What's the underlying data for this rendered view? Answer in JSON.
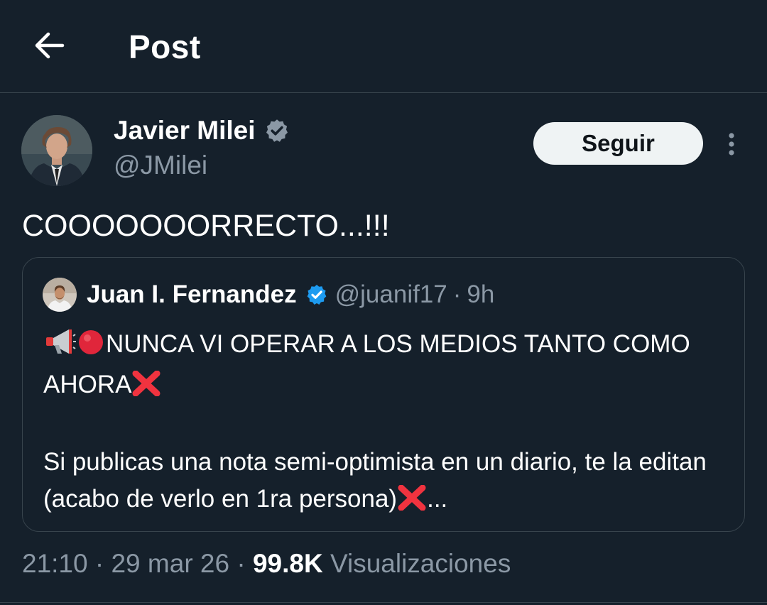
{
  "header": {
    "back_icon": "arrow-left-icon",
    "title": "Post"
  },
  "author": {
    "name": "Javier Milei",
    "handle": "@JMilei",
    "verified_icon": "verified-badge-icon",
    "verified_color": "#8b98a5"
  },
  "follow_button": {
    "label": "Seguir"
  },
  "more_icon": "more-vertical-icon",
  "tweet": {
    "text": "COOOOOOORRECTO...!!!"
  },
  "quote": {
    "name": "Juan I. Fernandez",
    "handle": "@juanif17",
    "separator": "·",
    "time": "9h",
    "verified_color": "#1d9bf0",
    "paragraph_1": "NUNCA VI OPERAR A LOS MEDIOS TANTO COMO AHORA",
    "paragraph_2": "Si publicas una nota semi-optimista en un diario, te la editan (acabo de verlo en 1ra persona)",
    "ellipsis": "..."
  },
  "meta": {
    "time": "21:10",
    "sep_1": " · ",
    "date": "29 mar 26",
    "sep_2": " · ",
    "views_count": "99.8K",
    "views_label": " Visualizaciones"
  },
  "colors": {
    "background": "#15202b",
    "divider": "#38444d",
    "secondary_text": "#8b98a5",
    "follow_bg": "#eff3f4"
  }
}
